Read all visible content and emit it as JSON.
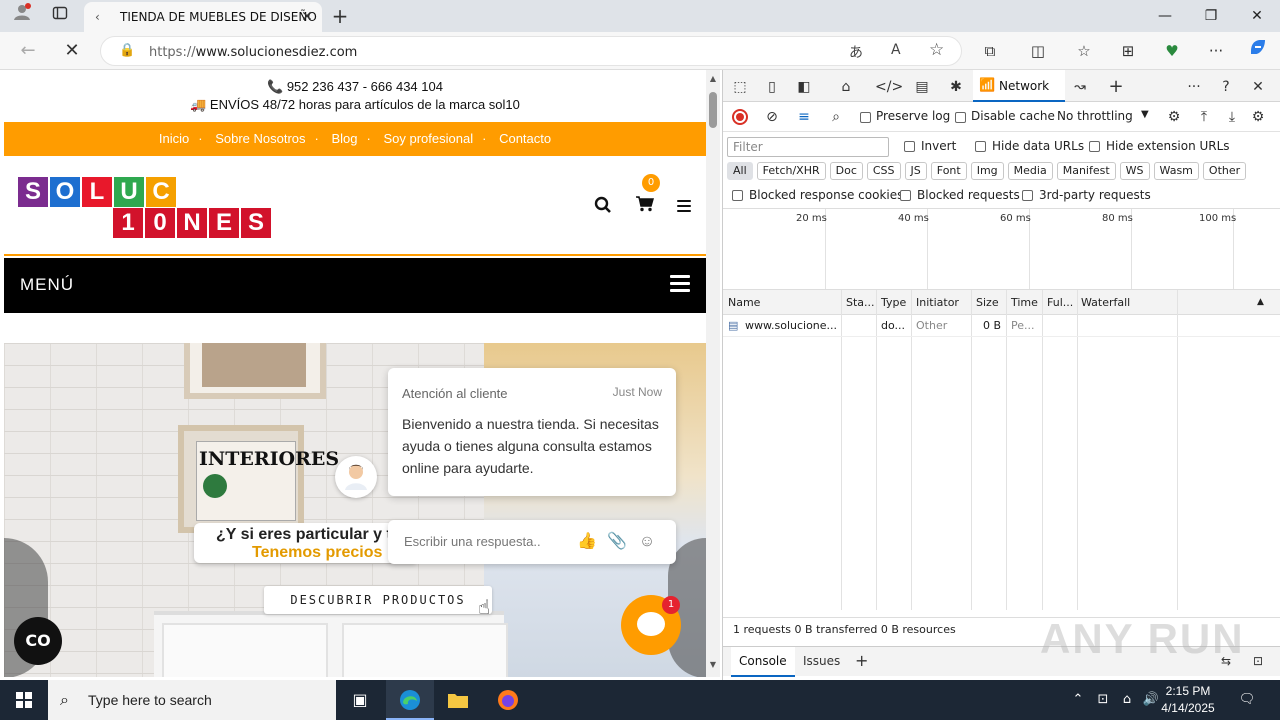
{
  "browser": {
    "tab_title": "TIENDA DE MUEBLES DE DISEÑO",
    "url_prefix": "https://",
    "url_host": "www.solucionesdiez.com"
  },
  "site": {
    "phones": "📞 952 236 437 - 666 434 104",
    "shipping": "🚚 ENVÍOS 48/72 horas para artículos de la marca sol10",
    "nav": [
      "Inicio",
      "Sobre Nosotros",
      "Blog",
      "Soy profesional",
      "Contacto"
    ],
    "logo_row1": [
      "S",
      "O",
      "L",
      "U",
      "C"
    ],
    "logo_row2": [
      "1",
      "0",
      "N",
      "E",
      "S"
    ],
    "logo_colors_row1": [
      "#7b2c8f",
      "#1e6fd0",
      "#e8182b",
      "#2fa84f",
      "#f5a000"
    ],
    "logo_colors_row2": [
      "#d2122b",
      "#d2122b",
      "#d2122b",
      "#d2122b",
      "#d2122b"
    ],
    "cart_count": "0",
    "menu_label": "MENÚ",
    "hero": {
      "magazine_title": "INTERIORES",
      "line1": "¿Y si eres particular y t",
      "line2": "Tenemos precios",
      "cta": "DESCUBRIR PRODUCTOS"
    },
    "chat": {
      "agent": "Atención al cliente",
      "time": "Just Now",
      "message": "Bienvenido a nuestra tienda. Si necesitas ayuda o tienes alguna consulta estamos online para ayudarte.",
      "input_placeholder": "Escribir una respuesta..",
      "badge": "1"
    },
    "accessibility_label": "CO"
  },
  "devtools": {
    "active_tab": "Network",
    "preserve_log": "Preserve log",
    "disable_cache": "Disable cache",
    "throttling": "No throttling",
    "filter_placeholder": "Filter",
    "invert": "Invert",
    "hide_data_urls": "Hide data URLs",
    "hide_ext_urls": "Hide extension URLs",
    "type_filters": [
      "All",
      "Fetch/XHR",
      "Doc",
      "CSS",
      "JS",
      "Font",
      "Img",
      "Media",
      "Manifest",
      "WS",
      "Wasm",
      "Other"
    ],
    "blocked_cookies": "Blocked response cookies",
    "blocked_requests": "Blocked requests",
    "third_party": "3rd-party requests",
    "timeline_ticks": [
      "20 ms",
      "40 ms",
      "60 ms",
      "80 ms",
      "100 ms"
    ],
    "columns": [
      "Name",
      "Sta...",
      "Type",
      "Initiator",
      "Size",
      "Time",
      "Ful...",
      "Waterfall"
    ],
    "rows": [
      {
        "name": "www.solucione...",
        "status": "",
        "type": "do...",
        "initiator": "Other",
        "size": "0 B",
        "time": "Pe...",
        "full": ""
      }
    ],
    "summary": "1 requests  0 B transferred  0 B resources",
    "drawer_tabs": [
      "Console",
      "Issues"
    ]
  },
  "watermark": "ANY RUN",
  "taskbar": {
    "search_placeholder": "Type here to search",
    "time": "2:15 PM",
    "date": "4/14/2025"
  }
}
